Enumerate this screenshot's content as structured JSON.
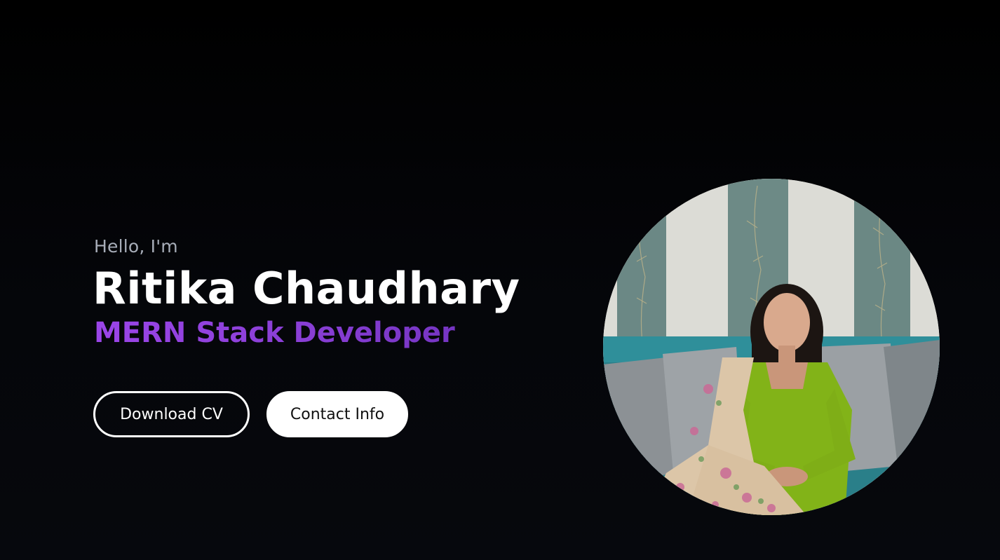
{
  "hero": {
    "greeting": "Hello, I'm",
    "name": "Ritika Chaudhary",
    "role": "MERN Stack Developer"
  },
  "buttons": {
    "download_cv": "Download CV",
    "contact_info": "Contact Info"
  },
  "colors": {
    "background": "#000000",
    "greeting": "#a7adb8",
    "name": "#ffffff",
    "role_gradient_start": "#9b45e8",
    "role_gradient_end": "#6a2fb8",
    "button_outline": "#ffffff",
    "button_solid_bg": "#ffffff",
    "button_solid_text": "#111111"
  },
  "profile_photo": {
    "icon": "profile-photo"
  }
}
